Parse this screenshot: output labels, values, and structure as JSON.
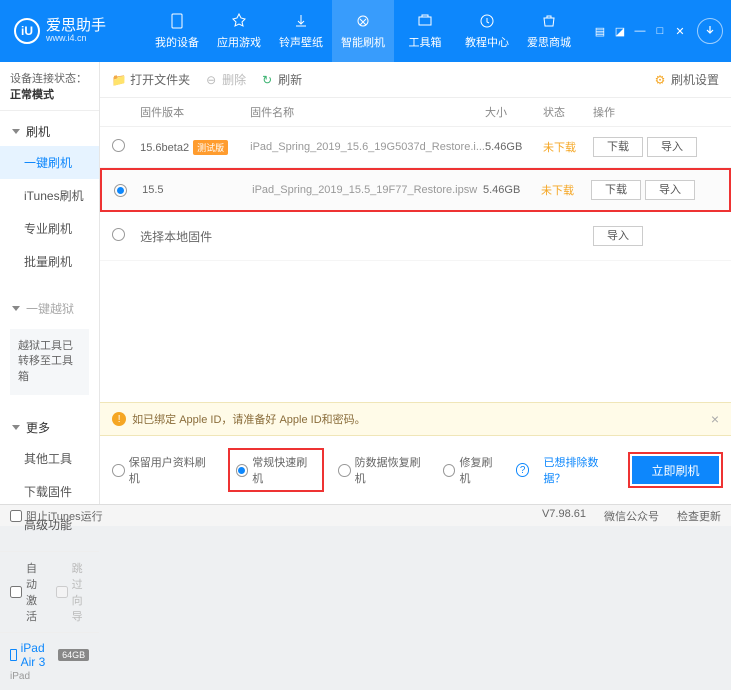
{
  "brand": {
    "cn": "爱思助手",
    "url": "www.i4.cn",
    "logo": "iU"
  },
  "nav": [
    {
      "label": "我的设备"
    },
    {
      "label": "应用游戏"
    },
    {
      "label": "铃声壁纸"
    },
    {
      "label": "智能刷机",
      "active": true
    },
    {
      "label": "工具箱"
    },
    {
      "label": "教程中心"
    },
    {
      "label": "爱思商城"
    }
  ],
  "sidebar": {
    "conn_label": "设备连接状态：",
    "conn_value": "正常模式",
    "flash_title": "刷机",
    "flash_tabs": [
      "一键刷机",
      "iTunes刷机",
      "专业刷机",
      "批量刷机"
    ],
    "jailbreak_title": "一键越狱",
    "jb_notice": "越狱工具已转移至工具箱",
    "more_title": "更多",
    "more_tabs": [
      "其他工具",
      "下载固件",
      "高级功能"
    ],
    "auto_activate": "自动激活",
    "skip_guide": "跳过向导"
  },
  "device": {
    "name": "iPad Air 3",
    "capacity": "64GB",
    "model": "iPad"
  },
  "toolbar": {
    "open": "打开文件夹",
    "delete": "删除",
    "refresh": "刷新",
    "settings": "刷机设置"
  },
  "table": {
    "headers": {
      "ver": "固件版本",
      "name": "固件名称",
      "size": "大小",
      "stat": "状态",
      "act": "操作"
    },
    "btn_download": "下载",
    "btn_import": "导入",
    "rows": [
      {
        "ver": "15.6beta2",
        "badge": "测试版",
        "name": "iPad_Spring_2019_15.6_19G5037d_Restore.i...",
        "size": "5.46GB",
        "stat": "未下载",
        "selected": false,
        "hl": false
      },
      {
        "ver": "15.5",
        "badge": "",
        "name": "iPad_Spring_2019_15.5_19F77_Restore.ipsw",
        "size": "5.46GB",
        "stat": "未下载",
        "selected": true,
        "hl": true
      }
    ],
    "select_local": "选择本地固件"
  },
  "alert": "如已绑定 Apple ID，请准备好 Apple ID和密码。",
  "options": {
    "keep": "保留用户资料刷机",
    "normal": "常规快速刷机",
    "anti": "防数据恢复刷机",
    "repair": "修复刷机",
    "exclude": "已想排除数据？",
    "go": "立即刷机"
  },
  "statusbar": {
    "block": "阻止iTunes运行",
    "ver": "V7.98.61",
    "wx": "微信公众号",
    "update": "检查更新"
  }
}
